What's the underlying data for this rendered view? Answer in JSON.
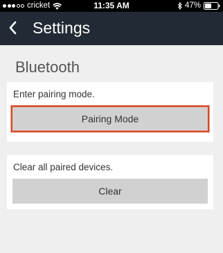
{
  "status_bar": {
    "carrier": "cricket",
    "time": "11:35 AM",
    "battery_percent": "47%",
    "signal_bars": 3,
    "icons": [
      "signal-dots-icon",
      "wifi-icon",
      "bluetooth-icon",
      "battery-icon"
    ]
  },
  "nav": {
    "back_icon": "chevron-left-icon",
    "title": "Settings"
  },
  "section": {
    "title": "Bluetooth"
  },
  "pairing": {
    "label": "Enter pairing mode.",
    "button_label": "Pairing Mode"
  },
  "clear": {
    "label": "Clear all paired devices.",
    "button_label": "Clear"
  },
  "colors": {
    "nav_background": "#222b35",
    "page_background": "#efefef",
    "button_background": "#d1d1d1",
    "highlight_border": "#d24a2a"
  }
}
